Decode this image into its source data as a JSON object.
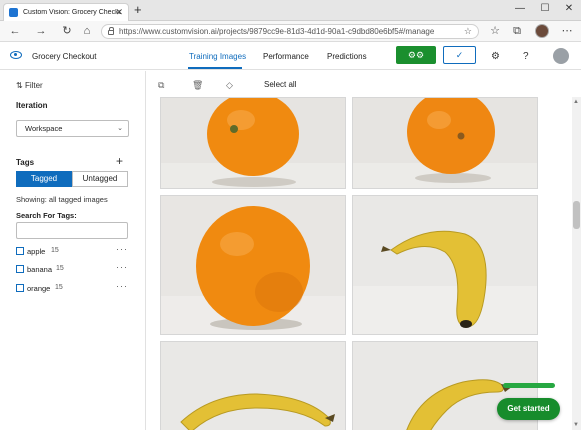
{
  "browser": {
    "tab_title": "Custom Vision: Grocery Checkout",
    "tab_close": "✕",
    "new_tab": "+",
    "url": "https://www.customvision.ai/projects/9879cc9e-81d3-4d1d-90a1-c9dbd80e6bf5#/manage",
    "window_controls": {
      "minimize": "—",
      "maximize": "☐",
      "close": "✕"
    },
    "nav": {
      "back": "←",
      "forward": "→",
      "home": "⌂"
    }
  },
  "app": {
    "project_name": "Grocery Checkout",
    "tabs": [
      {
        "label": "Training Images",
        "active": true
      },
      {
        "label": "Performance",
        "active": false
      },
      {
        "label": "Predictions",
        "active": false
      }
    ],
    "train_icon": "⚙⚙",
    "quick_test_icon": "✓",
    "settings_icon": "⚙",
    "help_icon": "?"
  },
  "sidebar": {
    "filter_label": "Filter",
    "iteration_title": "Iteration",
    "iteration_value": "Workspace",
    "tags_title": "Tags",
    "add_tag_icon": "+",
    "toggle": {
      "tagged": "Tagged",
      "untagged": "Untagged"
    },
    "showing_text": "Showing: all tagged images",
    "search_label": "Search For Tags:",
    "search_value": "",
    "tags": [
      {
        "name": "apple",
        "count": "15"
      },
      {
        "name": "banana",
        "count": "15"
      },
      {
        "name": "orange",
        "count": "15"
      }
    ],
    "tag_more": "···"
  },
  "toolbar": {
    "select_all": "Select all"
  },
  "grid": {
    "images": [
      {
        "label": "orange"
      },
      {
        "label": "orange"
      },
      {
        "label": "orange"
      },
      {
        "label": "banana"
      },
      {
        "label": "banana"
      },
      {
        "label": "banana"
      }
    ]
  },
  "tour": {
    "progress": 1.0,
    "get_started": "Get started"
  },
  "colors": {
    "accent": "#0f6cbd",
    "train_green": "#1a8f2e",
    "orange_fruit": "#f08a10",
    "banana": "#e3c035"
  }
}
